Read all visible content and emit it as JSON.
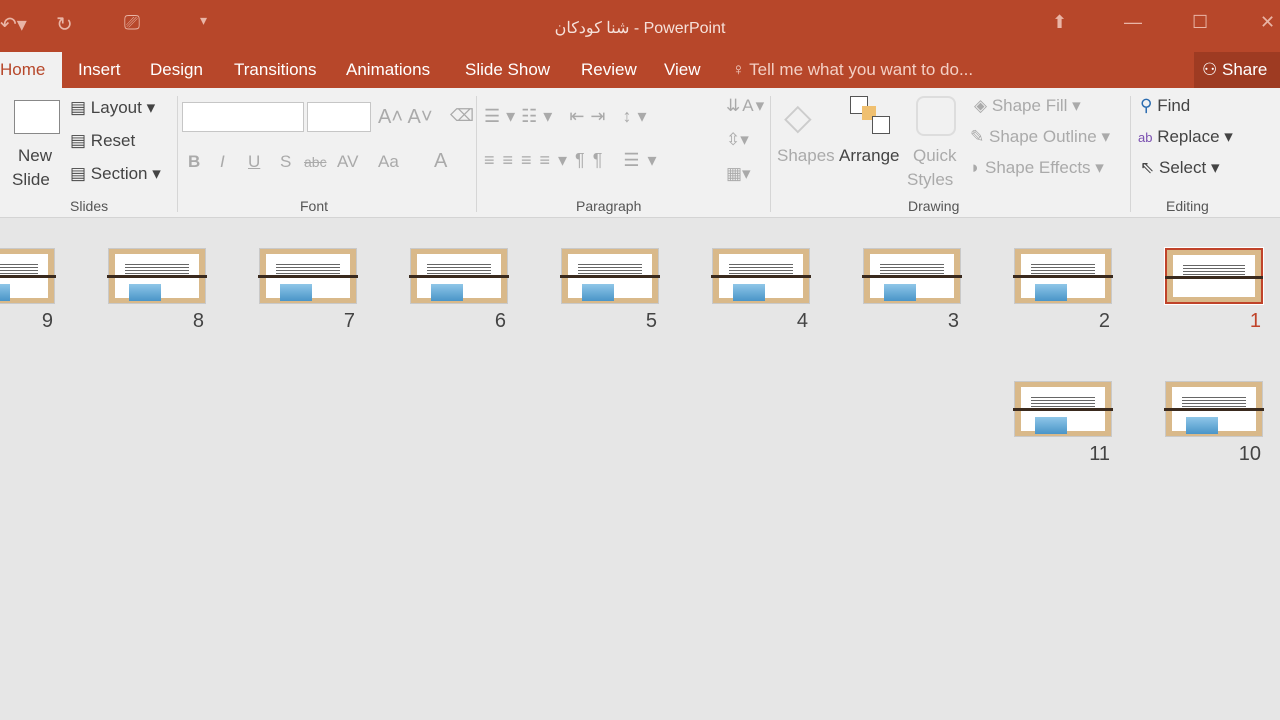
{
  "window": {
    "title": "شنا کودکان - PowerPoint"
  },
  "tabs": [
    "Home",
    "Insert",
    "Design",
    "Transitions",
    "Animations",
    "Slide Show",
    "Review",
    "View"
  ],
  "tell_me": "Tell me what you want to do...",
  "share": "Share",
  "ribbon": {
    "slides": {
      "group": "Slides",
      "new_slide_1": "New",
      "new_slide_2": "Slide",
      "layout": "Layout",
      "reset": "Reset",
      "section": "Section"
    },
    "font": {
      "group": "Font",
      "bold": "B",
      "italic": "I",
      "underline": "U",
      "shadow": "S",
      "strike": "abc",
      "spacing": "AV",
      "case": "Aa",
      "color": "A"
    },
    "paragraph": {
      "group": "Paragraph"
    },
    "drawing": {
      "group": "Drawing",
      "shapes": "Shapes",
      "arrange": "Arrange",
      "quick_1": "Quick",
      "quick_2": "Styles",
      "fill": "Shape Fill",
      "outline": "Shape Outline",
      "effects": "Shape Effects"
    },
    "editing": {
      "group": "Editing",
      "find": "Find",
      "replace": "Replace",
      "select": "Select"
    }
  },
  "slides": [
    {
      "n": "1",
      "selected": true
    },
    {
      "n": "2"
    },
    {
      "n": "3"
    },
    {
      "n": "4"
    },
    {
      "n": "5"
    },
    {
      "n": "6"
    },
    {
      "n": "7"
    },
    {
      "n": "8"
    },
    {
      "n": "9"
    },
    {
      "n": "10"
    },
    {
      "n": "11"
    }
  ],
  "colors": {
    "accent": "#b7472a",
    "selected": "#c0432a"
  }
}
